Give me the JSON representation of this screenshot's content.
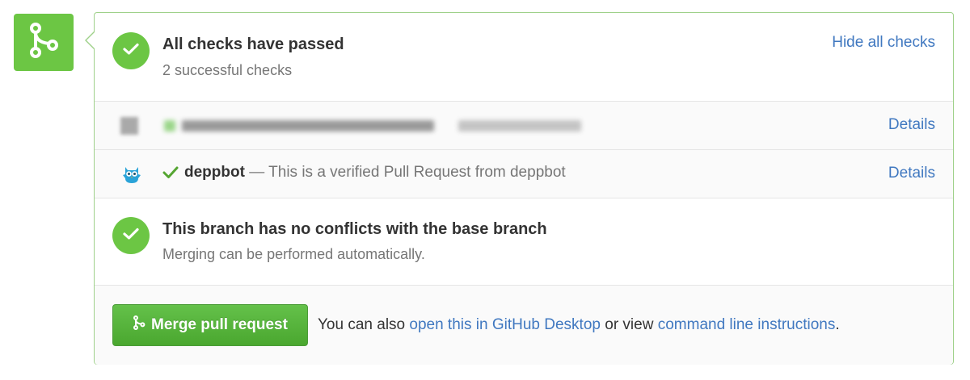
{
  "checks_header": {
    "title": "All checks have passed",
    "subtitle": "2 successful checks",
    "hide_link": "Hide all checks"
  },
  "checks": [
    {
      "context": "",
      "description": "",
      "details_label": "Details",
      "redacted": true
    },
    {
      "context": "deppbot",
      "separator": "—",
      "description": "This is a verified Pull Request from deppbot",
      "details_label": "Details",
      "icon": "owl-bot-icon",
      "status_icon": "check-icon"
    }
  ],
  "conflicts": {
    "title": "This branch has no conflicts with the base branch",
    "subtitle": "Merging can be performed automatically."
  },
  "merge": {
    "button_label": "Merge pull request",
    "prefix": "You can also",
    "desktop_link": "open this in GitHub Desktop",
    "middle": "or view",
    "cli_link": "command line instructions",
    "suffix": "."
  },
  "colors": {
    "success": "#6cc644",
    "link": "#4078c0",
    "border": "#9fd18a"
  }
}
